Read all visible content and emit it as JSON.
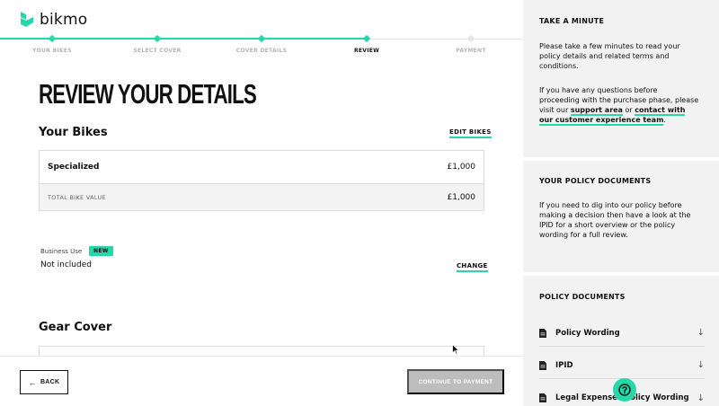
{
  "brand": {
    "name": "bikmo",
    "accent": "#25d7a9"
  },
  "progress": {
    "steps": [
      {
        "label": "YOUR BIKES",
        "state": "done"
      },
      {
        "label": "SELECT COVER",
        "state": "done"
      },
      {
        "label": "COVER DETAILS",
        "state": "done"
      },
      {
        "label": "REVIEW",
        "state": "active"
      },
      {
        "label": "PAYMENT",
        "state": "pending"
      }
    ]
  },
  "main": {
    "title": "REVIEW YOUR DETAILS",
    "bikes": {
      "heading": "Your Bikes",
      "edit_label": "EDIT BIKES",
      "rows": [
        {
          "name": "Specialized",
          "price": "£1,000"
        }
      ],
      "total": {
        "label": "TOTAL BIKE VALUE",
        "price": "£1,000"
      }
    },
    "business_use": {
      "label": "Business Use",
      "badge": "NEW",
      "value": "Not included",
      "change_label": "CHANGE"
    },
    "gear": {
      "heading": "Gear Cover"
    }
  },
  "footer": {
    "back_label": "BACK",
    "continue_label": "CONTINUE TO PAYMENT"
  },
  "sidebar": {
    "take_a_minute": {
      "title": "TAKE A MINUTE",
      "para1": "Please take a few minutes to read your policy details and related terms and conditions.",
      "para2_pre": "If you have any questions before proceeding with the purchase phase, please visit our ",
      "support_link": "support area",
      "para2_mid": " or ",
      "contact_link": "contact with our customer experience team",
      "para2_post": "."
    },
    "your_docs": {
      "title": "YOUR POLICY DOCUMENTS",
      "text": "If you need to dig into our policy before making a decision then have a look at the IPID for a short overview or the policy wording for a full review."
    },
    "policy_docs": {
      "title": "POLICY DOCUMENTS",
      "items": [
        {
          "label": "Policy Wording"
        },
        {
          "label": "IPID"
        },
        {
          "label": "Legal Expenses Policy Wording"
        }
      ]
    }
  }
}
